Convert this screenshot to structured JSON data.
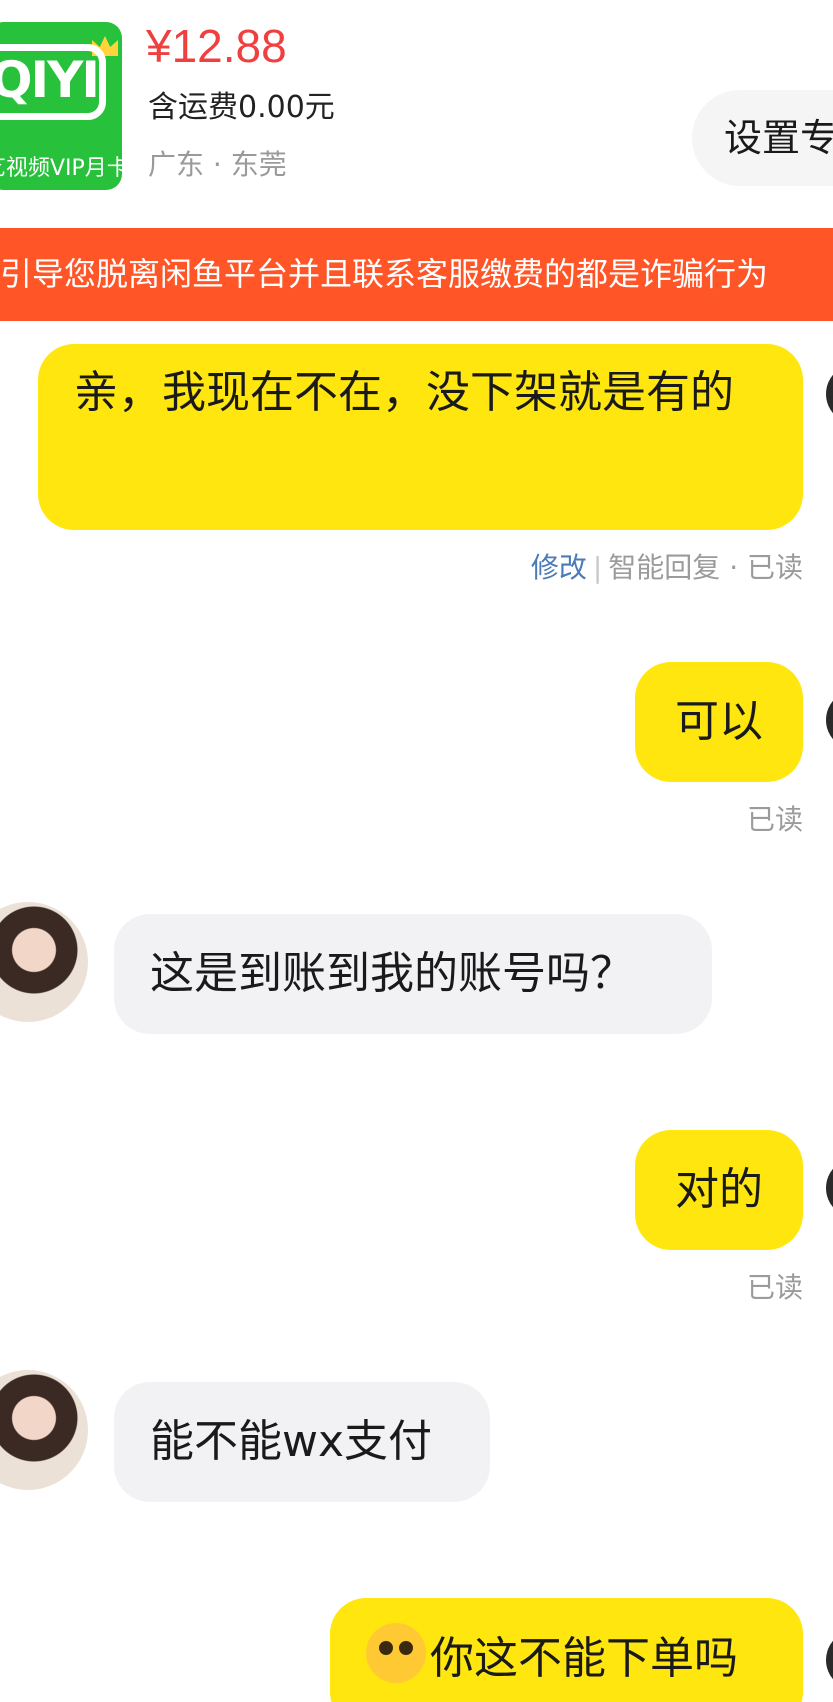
{
  "product": {
    "thumbnail_logo": "QIYI",
    "thumbnail_caption": "艺视频VIP月卡",
    "price": "¥12.88",
    "shipping": "含运费0.00元",
    "location": "广东 · 东莞",
    "settings_button": "设置专"
  },
  "warning_banner": "引导您脱离闲鱼平台并且联系客服缴费的都是诈骗行为",
  "messages": [
    {
      "side": "out",
      "text": "亲，我现在不在，没下架就是有的",
      "meta_edit": "修改",
      "meta_status": "智能回复 · 已读"
    },
    {
      "side": "out",
      "text": "可以",
      "meta_status": "已读"
    },
    {
      "side": "in",
      "text": "这是到账到我的账号吗？"
    },
    {
      "side": "out",
      "text": "对的",
      "meta_status": "已读"
    },
    {
      "side": "in",
      "text": "能不能wx支付"
    },
    {
      "side": "out",
      "text": "你这不能下单吗",
      "emoji": "astonished-face"
    }
  ],
  "colors": {
    "price": "#ef3f3f",
    "banner": "#ff5527",
    "out_bubble": "#ffe60f",
    "in_bubble": "#f2f2f4",
    "edit_link": "#4a7ab8",
    "thumbnail_bg": "#27c13b"
  }
}
